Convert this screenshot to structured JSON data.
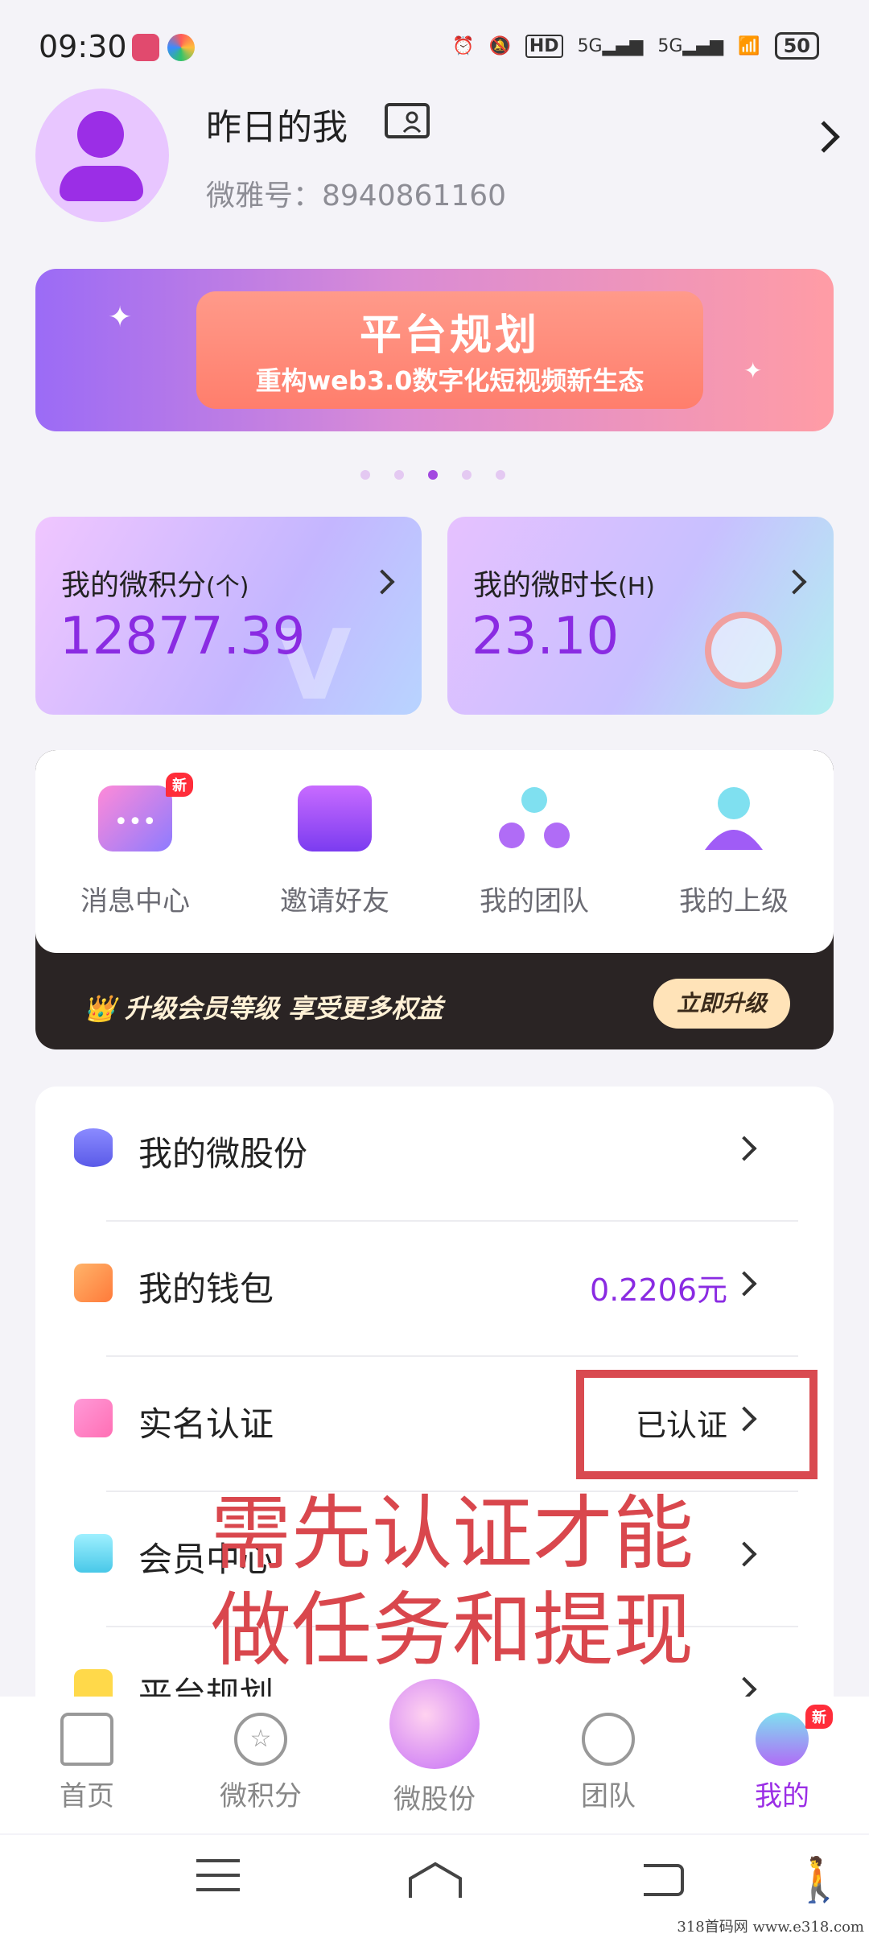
{
  "status_bar": {
    "time": "09:30",
    "network_1": "5G",
    "network_2": "5G",
    "hd": "HD",
    "battery": "50"
  },
  "profile": {
    "username": "昨日的我",
    "user_id": "微雅号：8940861160"
  },
  "banner": {
    "title": "平台规划",
    "subtitle": "重构web3.0数字化短视频新生态",
    "page_count": 5,
    "active_page": 3
  },
  "stats": {
    "points_label": "我的微积分",
    "points_unit": "(个)",
    "points_value": "12877.39",
    "duration_label": "我的微时长",
    "duration_unit": "(H)",
    "duration_value": "23.10"
  },
  "quick_actions": [
    {
      "label": "消息中心",
      "badge": "新"
    },
    {
      "label": "邀请好友"
    },
    {
      "label": "我的团队"
    },
    {
      "label": "我的上级"
    }
  ],
  "upgrade": {
    "text": "升级会员等级  享受更多权益",
    "button": "立即升级"
  },
  "menu": [
    {
      "label": "我的微股份",
      "value": ""
    },
    {
      "label": "我的钱包",
      "value": "0.2206元"
    },
    {
      "label": "实名认证",
      "value": "已认证"
    },
    {
      "label": "会员中心",
      "value": ""
    },
    {
      "label": "平台规划",
      "value": ""
    }
  ],
  "annotation": {
    "line1": "需先认证才能",
    "line2": "做任务和提现"
  },
  "bottom_nav": [
    {
      "label": "首页"
    },
    {
      "label": "微积分"
    },
    {
      "label": "微股份"
    },
    {
      "label": "团队"
    },
    {
      "label": "我的",
      "badge": "新"
    }
  ],
  "watermark": "318首码网  www.e318.com",
  "colors": {
    "accent": "#9b2ee6",
    "value_purple": "#8a2be2",
    "annotation_red": "#d94a50"
  }
}
